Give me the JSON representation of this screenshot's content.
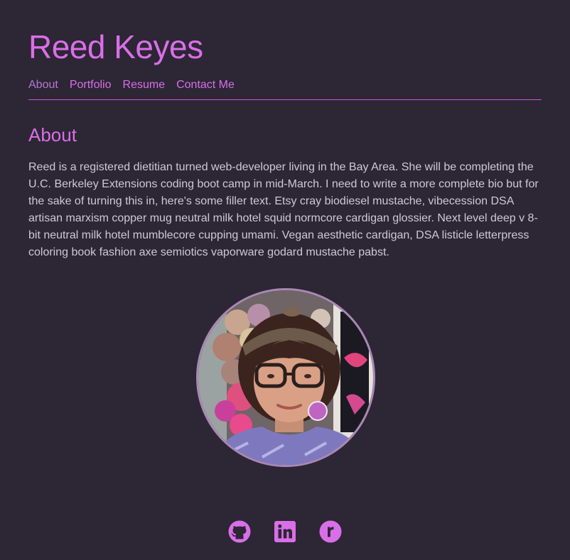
{
  "site": {
    "title": "Reed Keyes"
  },
  "nav": {
    "items": [
      {
        "label": "About"
      },
      {
        "label": "Portfolio"
      },
      {
        "label": "Resume"
      },
      {
        "label": "Contact Me"
      }
    ]
  },
  "about": {
    "heading": "About",
    "bio": "Reed is a registered dietitian turned web-developer living in the Bay Area. She will be completing the U.C. Berkeley Extensions coding boot camp in mid-March. I need to write a more complete bio but for the sake of turning this in, here's some filler text. Etsy cray biodiesel mustache, vibecession DSA artisan marxism copper mug neutral milk hotel squid normcore cardigan glossier. Next level deep v 8-bit neutral milk hotel mumblecore cupping umami. Vegan aesthetic cardigan, DSA listicle letterpress coloring book fashion axe semiotics vaporware godard mustache pabst."
  },
  "profile_photo": {
    "icon": "profile-photo"
  },
  "social": {
    "icons": [
      "github-icon",
      "linkedin-icon",
      "r-icon"
    ]
  },
  "colors": {
    "background": "#2d2635",
    "accent": "#d96fe8",
    "body_text": "#cfc9d6",
    "avatar_border": "#a987b4"
  }
}
